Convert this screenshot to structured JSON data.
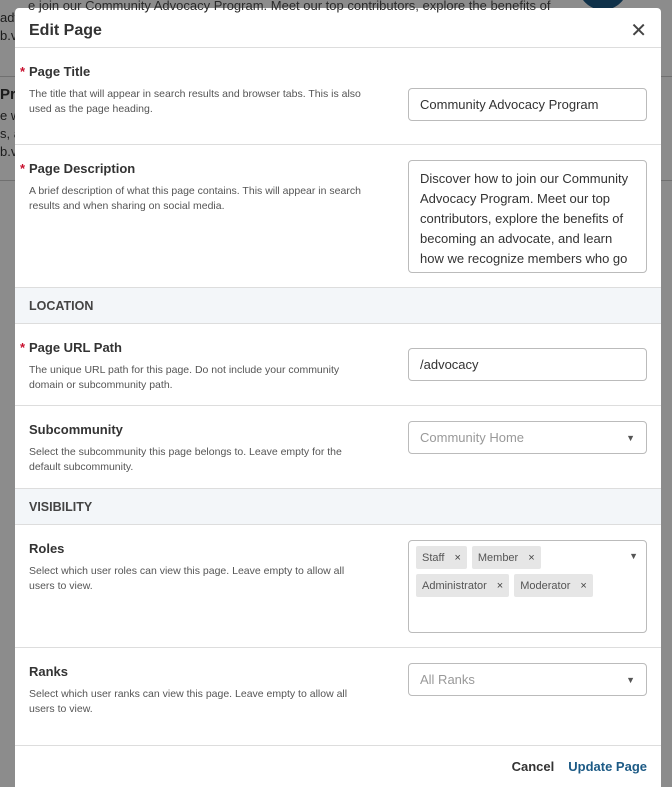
{
  "background": {
    "line1": "e join our Community Advocacy Program. Meet our top contributors, explore the benefits of",
    "line2": "adv",
    "line3": "b.v",
    "line4": "Pr",
    "line5": "e w",
    "line6": "s, a",
    "line7": "b.v"
  },
  "modal": {
    "title": "Edit Page",
    "close_icon": "close-icon",
    "fields": {
      "page_title": {
        "label": "Page Title",
        "required": "*",
        "help": "The title that will appear in search results and browser tabs. This is also used as the page heading.",
        "value": "Community Advocacy Program"
      },
      "page_description": {
        "label": "Page Description",
        "required": "*",
        "help": "A brief description of what this page contains. This will appear in search results and when sharing on social media.",
        "value": "Discover how to join our Community Advocacy Program. Meet our top contributors, explore the benefits of becoming an advocate, and learn how we recognize members who go above and beyond."
      },
      "url_path": {
        "label": "Page URL Path",
        "required": "*",
        "help": "The unique URL path for this page. Do not include your community domain or subcommunity path.",
        "value": "/advocacy"
      },
      "subcommunity": {
        "label": "Subcommunity",
        "help": "Select the subcommunity this page belongs to. Leave empty for the default subcommunity.",
        "placeholder": "Community Home"
      },
      "roles": {
        "label": "Roles",
        "help": "Select which user roles can view this page. Leave empty to allow all users to view.",
        "tags": [
          "Staff",
          "Member",
          "Administrator",
          "Moderator"
        ],
        "remove": "×"
      },
      "ranks": {
        "label": "Ranks",
        "help": "Select which user ranks can view this page. Leave empty to allow all users to view.",
        "placeholder": "All Ranks"
      }
    },
    "sections": {
      "location": "LOCATION",
      "visibility": "VISIBILITY"
    },
    "footer": {
      "cancel": "Cancel",
      "update": "Update Page"
    }
  }
}
